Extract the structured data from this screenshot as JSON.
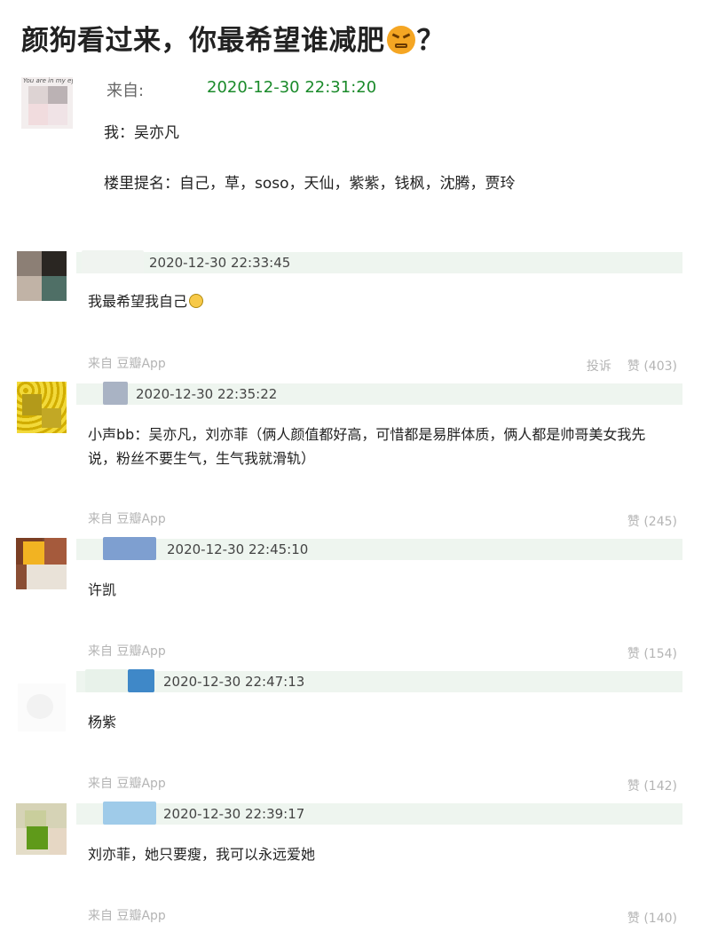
{
  "post": {
    "title": "颜狗看过来，你最希望谁减肥",
    "title_end": "？",
    "emoji_icon": "persevering-face-emoji",
    "avatar_caption": "You are in my eyes",
    "from_label": "来自:",
    "timestamp": "2020-12-30 22:31:20",
    "line1": "我：吴亦凡",
    "line2": "楼里提名：自己，草，soso，天仙，紫紫，钱枫，沈腾，贾玲"
  },
  "comments": [
    {
      "time": "2020-12-30 22:33:45",
      "text": "我最希望我自己",
      "emoji_icon": "smiling-face-emoji",
      "source": "来自 豆瓣App",
      "report_label": "投诉",
      "likes": "赞 (403)"
    },
    {
      "time": "2020-12-30 22:35:22",
      "text": "小声bb：吴亦凡，刘亦菲（俩人颜值都好高，可惜都是易胖体质，俩人都是帅哥美女我先说，粉丝不要生气，生气我就滑轨）",
      "source": "来自 豆瓣App",
      "likes": "赞 (245)"
    },
    {
      "time": "2020-12-30 22:45:10",
      "text": "许凯",
      "source": "来自 豆瓣App",
      "likes": "赞 (154)"
    },
    {
      "time": "2020-12-30 22:47:13",
      "text": "杨紫",
      "source": "来自 豆瓣App",
      "likes": "赞 (142)"
    },
    {
      "time": "2020-12-30 22:39:17",
      "text": "刘亦菲，她只要瘦，我可以永远爱她",
      "source": "来自 豆瓣App",
      "likes": "赞 (140)"
    }
  ],
  "colors": {
    "timestamp_green": "#1a8a2a",
    "bar_bg": "#eef5ef",
    "muted": "#b4b4b4"
  }
}
